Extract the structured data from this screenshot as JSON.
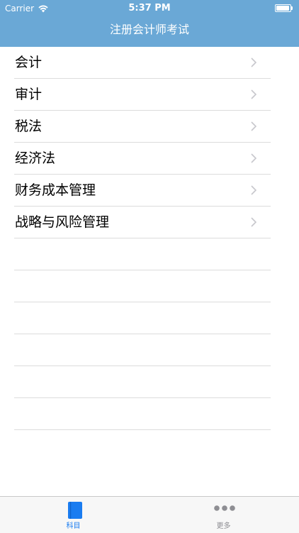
{
  "status_bar": {
    "carrier": "Carrier",
    "time": "5:37 PM"
  },
  "nav": {
    "title": "注册会计师考试"
  },
  "subjects": [
    {
      "label": "会计"
    },
    {
      "label": "审计"
    },
    {
      "label": "税法"
    },
    {
      "label": "经济法"
    },
    {
      "label": "财务成本管理"
    },
    {
      "label": "战略与风险管理"
    }
  ],
  "tabs": [
    {
      "label": "科目",
      "icon": "book-icon",
      "selected": true
    },
    {
      "label": "更多",
      "icon": "more-dots-icon",
      "selected": false
    }
  ],
  "colors": {
    "nav_background": "#6aa8d6",
    "tab_active": "#1a7cf0",
    "tab_inactive": "#8e8e93",
    "separator": "#dcdcdc",
    "chevron": "#c7c7cc"
  }
}
